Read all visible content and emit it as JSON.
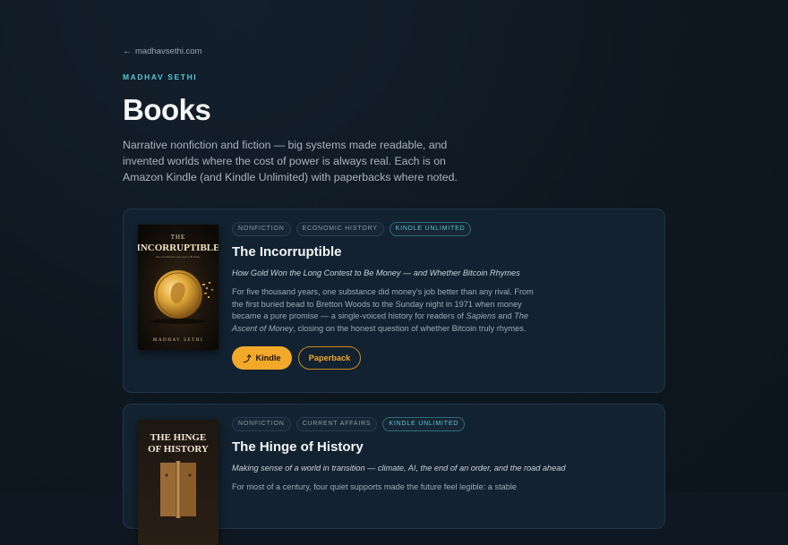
{
  "back_link": {
    "label": "madhavsethi.com",
    "icon": "arrow-left-icon"
  },
  "eyebrow": "MADHAV SETHI",
  "title": "Books",
  "intro": "Narrative nonfiction and fiction — big systems made readable, and invented worlds where the cost of power is always real. Each is on Amazon Kindle (and Kindle Unlimited) with paperbacks where noted.",
  "colors": {
    "accent_teal": "#59c7d6",
    "accent_gold": "#f2a92a",
    "card_bg": "#132230",
    "page_bg": "#0f1822"
  },
  "books": [
    {
      "cover": {
        "title_line1": "THE",
        "title_line2": "INCORRUPTIBLE",
        "tagline": "How Gold Won the Long Contest to Be Money",
        "author": "MADHAV SETHI"
      },
      "tags": [
        "NONFICTION",
        "ECONOMIC HISTORY",
        "KINDLE UNLIMITED"
      ],
      "title": "The Incorruptible",
      "subtitle": "How Gold Won the Long Contest to Be Money — and Whether Bitcoin Rhymes",
      "desc_part1": "For five thousand years, one substance did money's job better than any rival. From the first buried bead to Bretton Woods to the Sunday night in 1971 when money became a pure promise — a single-voiced history for readers of ",
      "desc_em1": "Sapiens",
      "desc_part2": " and ",
      "desc_em2": "The Ascent of Money",
      "desc_part3": ", closing on the honest question of whether Bitcoin truly rhymes.",
      "kindle_label": "Kindle",
      "paperback_label": "Paperback"
    },
    {
      "cover": {
        "title_line1": "THE HINGE",
        "title_line2": "OF HISTORY"
      },
      "tags": [
        "NONFICTION",
        "CURRENT AFFAIRS",
        "KINDLE UNLIMITED"
      ],
      "title": "The Hinge of History",
      "subtitle": "Making sense of a world in transition — climate, AI, the end of an order, and the road ahead",
      "desc": "For most of a century, four quiet supports made the future feel legible: a stable"
    }
  ]
}
